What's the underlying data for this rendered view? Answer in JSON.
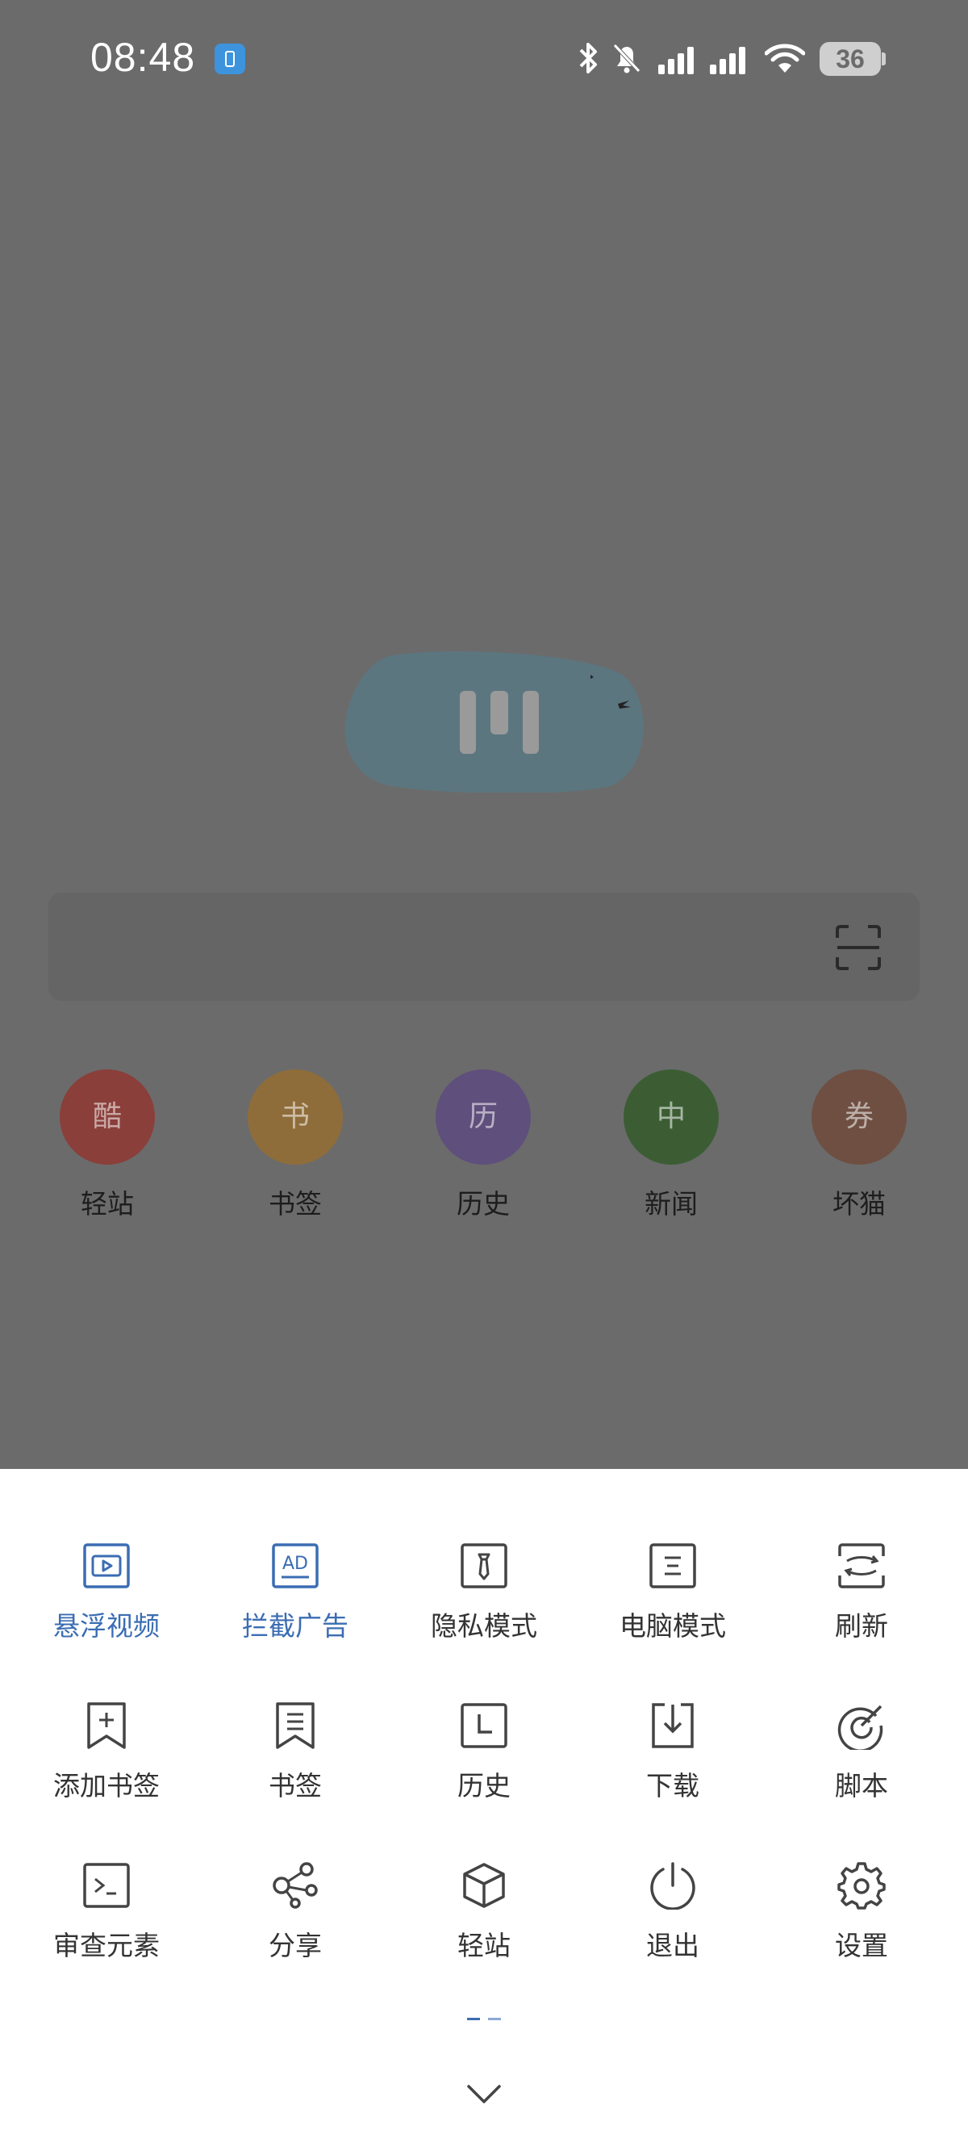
{
  "status_bar": {
    "time": "08:48",
    "battery": "36",
    "icons": [
      "bluetooth-icon",
      "mute-bell-icon",
      "signal-icon",
      "signal-icon",
      "wifi-icon"
    ]
  },
  "shortcuts": [
    {
      "glyph": "酷",
      "label": "轻站",
      "color": "#8a3f3a"
    },
    {
      "glyph": "书",
      "label": "书签",
      "color": "#8f6d3a"
    },
    {
      "glyph": "历",
      "label": "历史",
      "color": "#5f4f7c"
    },
    {
      "glyph": "中",
      "label": "新闻",
      "color": "#3c5d34"
    },
    {
      "glyph": "券",
      "label": "坏猫",
      "color": "#6e4f42"
    }
  ],
  "menu": {
    "rows": [
      [
        {
          "label": "悬浮视频",
          "icon": "floating-video-icon",
          "active": true
        },
        {
          "label": "拦截广告",
          "icon": "ad-block-icon",
          "active": true
        },
        {
          "label": "隐私模式",
          "icon": "privacy-mode-icon",
          "active": false
        },
        {
          "label": "电脑模式",
          "icon": "desktop-mode-icon",
          "active": false
        },
        {
          "label": "刷新",
          "icon": "refresh-icon",
          "active": false
        }
      ],
      [
        {
          "label": "添加书签",
          "icon": "add-bookmark-icon",
          "active": false
        },
        {
          "label": "书签",
          "icon": "bookmark-icon",
          "active": false
        },
        {
          "label": "历史",
          "icon": "history-icon",
          "active": false
        },
        {
          "label": "下载",
          "icon": "download-icon",
          "active": false
        },
        {
          "label": "脚本",
          "icon": "script-icon",
          "active": false
        }
      ],
      [
        {
          "label": "审查元素",
          "icon": "inspect-element-icon",
          "active": false
        },
        {
          "label": "分享",
          "icon": "share-icon",
          "active": false
        },
        {
          "label": "轻站",
          "icon": "light-site-icon",
          "active": false
        },
        {
          "label": "退出",
          "icon": "power-icon",
          "active": false
        },
        {
          "label": "设置",
          "icon": "settings-icon",
          "active": false
        }
      ]
    ]
  },
  "colors": {
    "accent": "#3b6db3",
    "icon": "#444444",
    "dim_overlay": "#6b6b6b",
    "sheet": "#ffffff"
  }
}
